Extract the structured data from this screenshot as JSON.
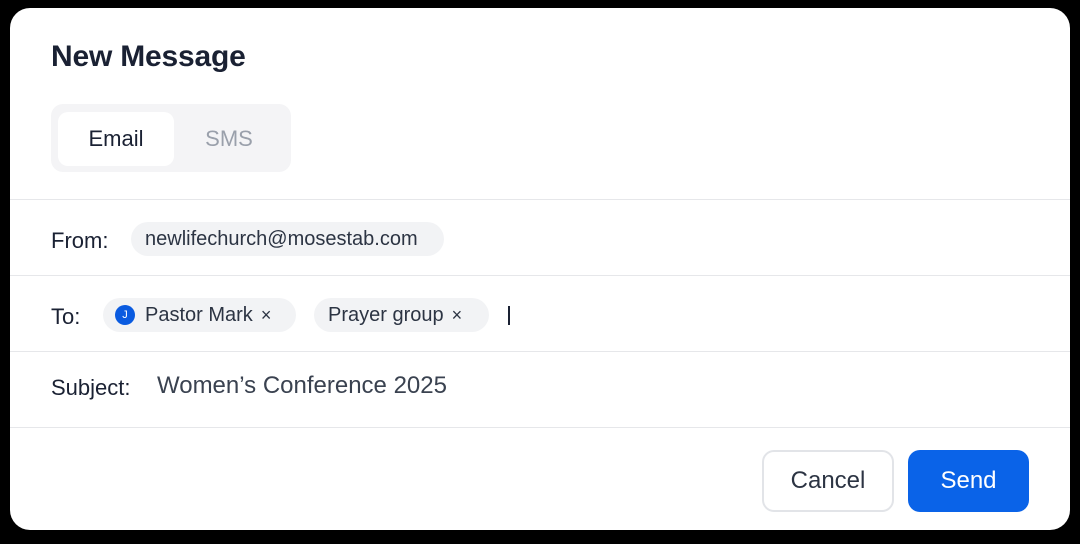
{
  "dialog": {
    "title": "New Message",
    "tabs": [
      {
        "label": "Email",
        "active": true
      },
      {
        "label": "SMS",
        "active": false
      }
    ],
    "from": {
      "label": "From:",
      "value": "newlifechurch@mosestab.com"
    },
    "to": {
      "label": "To:",
      "recipients": [
        {
          "name": "Pastor Mark",
          "avatar_initial": "J",
          "remove": "×"
        },
        {
          "name": "Prayer group",
          "remove": "×"
        }
      ]
    },
    "subject": {
      "label": "Subject:",
      "value": "Women’s Conference 2025"
    },
    "buttons": {
      "cancel": "Cancel",
      "send": "Send"
    }
  },
  "colors": {
    "accent": "#0a63e8",
    "title": "#1a2133",
    "muted": "#9aa0ab",
    "chip_bg": "#f2f3f5"
  }
}
